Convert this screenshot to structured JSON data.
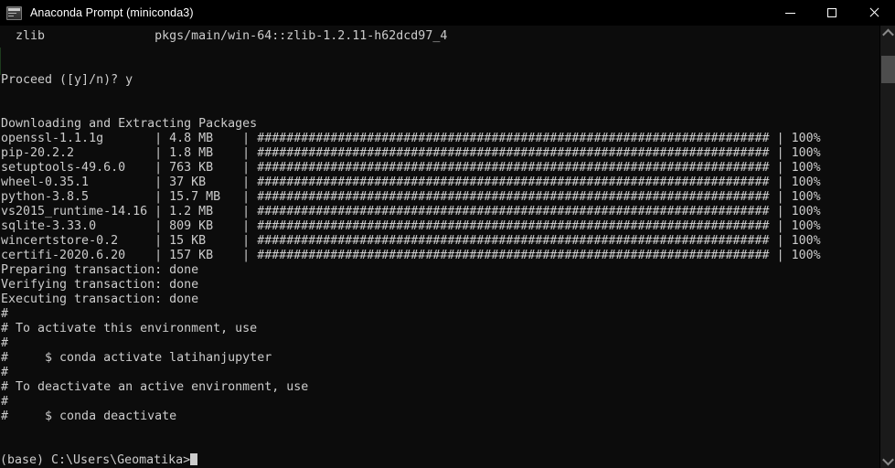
{
  "window": {
    "title": "Anaconda Prompt (miniconda3)",
    "icon": "console-icon",
    "controls": {
      "minimize_label": "Minimize",
      "maximize_label": "Maximize",
      "close_label": "Close"
    },
    "colors": {
      "titlebar_bg": "#000000",
      "console_bg": "#0c0c0c",
      "text": "#cccccc",
      "scrollbar_bg": "#1a1a1a",
      "scrollbar_thumb": "#4d4d4d"
    }
  },
  "scrollbar": {
    "up_arrow": "chevron-up-icon",
    "down_arrow": "chevron-down-icon",
    "thumb_position_percent": 4
  },
  "terminal": {
    "prompt": "(base) C:\\Users\\Geomatika>",
    "cursor_visible": true,
    "lines": [
      "  zlib               pkgs/main/win-64::zlib-1.2.11-h62dcd97_4",
      "",
      "",
      "Proceed ([y]/n)? y",
      "",
      "",
      "Downloading and Extracting Packages",
      "openssl-1.1.1g       | 4.8 MB    | ###################################################################### | 100%",
      "pip-20.2.2           | 1.8 MB    | ###################################################################### | 100%",
      "setuptools-49.6.0    | 763 KB    | ###################################################################### | 100%",
      "wheel-0.35.1         | 37 KB     | ###################################################################### | 100%",
      "python-3.8.5         | 15.7 MB   | ###################################################################### | 100%",
      "vs2015_runtime-14.16 | 1.2 MB    | ###################################################################### | 100%",
      "sqlite-3.33.0        | 809 KB    | ###################################################################### | 100%",
      "wincertstore-0.2     | 15 KB     | ###################################################################### | 100%",
      "certifi-2020.6.20    | 157 KB    | ###################################################################### | 100%",
      "Preparing transaction: done",
      "Verifying transaction: done",
      "Executing transaction: done",
      "#",
      "# To activate this environment, use",
      "#",
      "#     $ conda activate latihanjupyter",
      "#",
      "# To deactivate an active environment, use",
      "#",
      "#     $ conda deactivate",
      "",
      ""
    ],
    "packages": [
      {
        "name": "openssl-1.1.1g",
        "size": "4.8 MB",
        "progress": "100%"
      },
      {
        "name": "pip-20.2.2",
        "size": "1.8 MB",
        "progress": "100%"
      },
      {
        "name": "setuptools-49.6.0",
        "size": "763 KB",
        "progress": "100%"
      },
      {
        "name": "wheel-0.35.1",
        "size": "37 KB",
        "progress": "100%"
      },
      {
        "name": "python-3.8.5",
        "size": "15.7 MB",
        "progress": "100%"
      },
      {
        "name": "vs2015_runtime-14.16",
        "size": "1.2 MB",
        "progress": "100%"
      },
      {
        "name": "sqlite-3.33.0",
        "size": "809 KB",
        "progress": "100%"
      },
      {
        "name": "wincertstore-0.2",
        "size": "15 KB",
        "progress": "100%"
      },
      {
        "name": "certifi-2020.6.20",
        "size": "157 KB",
        "progress": "100%"
      }
    ],
    "environment_name": "latihanjupyter",
    "activate_command": "conda activate latihanjupyter",
    "deactivate_command": "conda deactivate",
    "transaction_status": {
      "preparing": "done",
      "verifying": "done",
      "executing": "done"
    }
  }
}
